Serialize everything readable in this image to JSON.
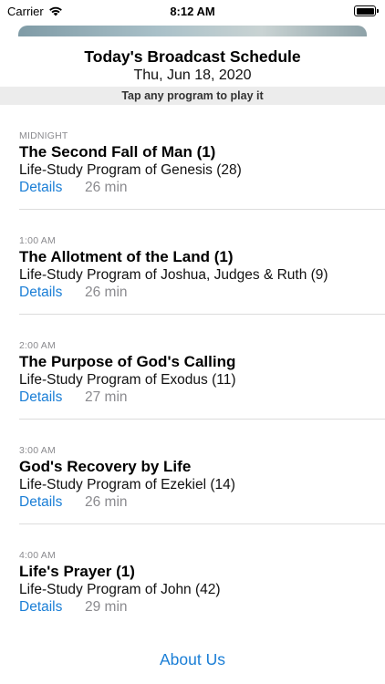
{
  "status_bar": {
    "carrier": "Carrier",
    "time": "8:12 AM"
  },
  "header": {
    "title": "Today's Broadcast Schedule",
    "date": "Thu, Jun 18, 2020",
    "hint": "Tap any program to play it"
  },
  "programs": [
    {
      "time": "MIDNIGHT",
      "title": "The Second Fall of Man (1)",
      "series": "Life-Study Program of Genesis (28)",
      "details_label": "Details",
      "duration": "26 min"
    },
    {
      "time": "1:00 AM",
      "title": "The Allotment of the Land (1)",
      "series": "Life-Study Program of Joshua, Judges & Ruth (9)",
      "details_label": "Details",
      "duration": "26 min"
    },
    {
      "time": "2:00 AM",
      "title": "The Purpose of God's Calling",
      "series": "Life-Study Program of Exodus (11)",
      "details_label": "Details",
      "duration": "27 min"
    },
    {
      "time": "3:00 AM",
      "title": "God's Recovery by Life",
      "series": "Life-Study Program of Ezekiel (14)",
      "details_label": "Details",
      "duration": "26 min"
    },
    {
      "time": "4:00 AM",
      "title": "Life's Prayer (1)",
      "series": "Life-Study Program of John (42)",
      "details_label": "Details",
      "duration": "29 min"
    }
  ],
  "footer": {
    "about_label": "About Us"
  },
  "colors": {
    "link": "#1a7ed6",
    "secondary_text": "#8a8a8e",
    "hint_bar": "#ececec"
  }
}
